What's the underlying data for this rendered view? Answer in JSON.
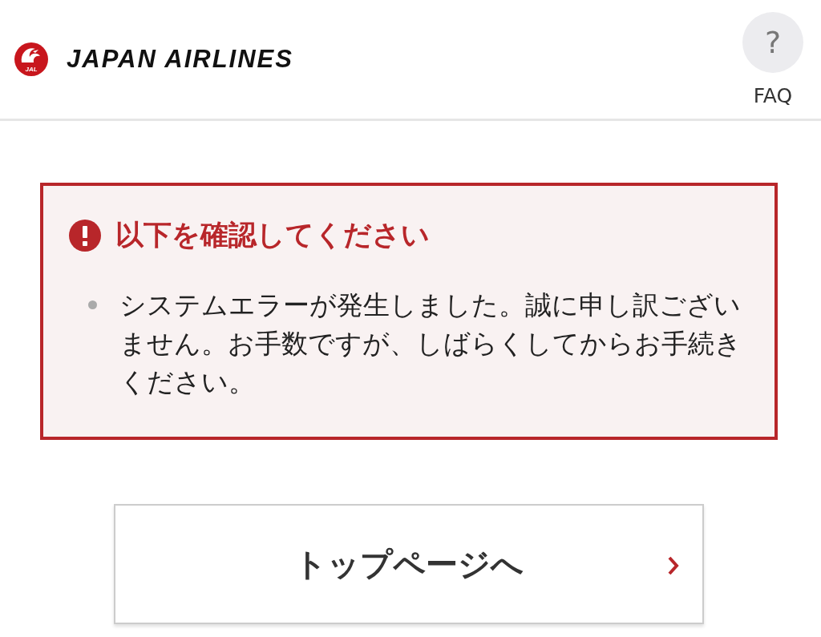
{
  "header": {
    "logo": {
      "emblem_text": "JAL",
      "wordmark": "JAPAN AIRLINES"
    },
    "faq": {
      "icon_text": "?",
      "label": "FAQ"
    }
  },
  "alert": {
    "title": "以下を確認してください",
    "messages": [
      "システムエラーが発生しました。誠に申し訳ございません。お手数ですが、しばらくしてからお手続きください。"
    ]
  },
  "button": {
    "label": "トップページへ"
  }
}
